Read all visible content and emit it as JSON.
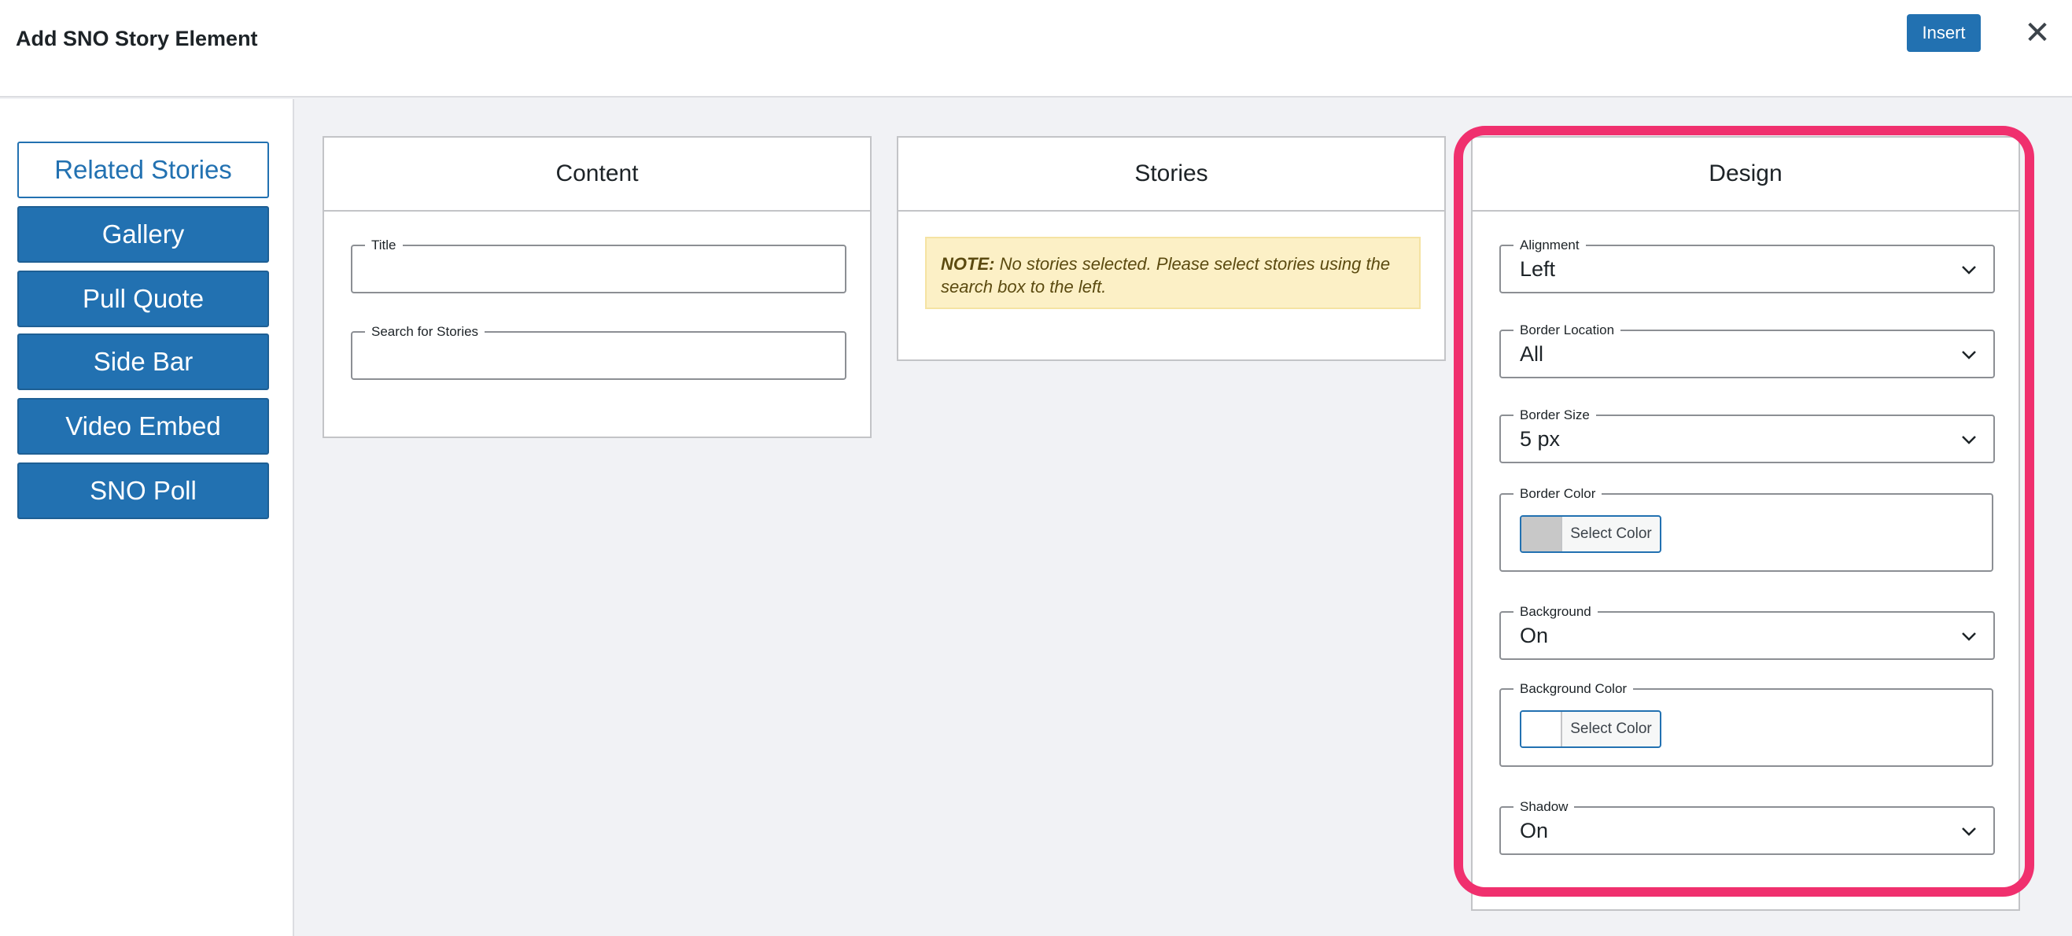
{
  "header": {
    "title": "Add SNO Story Element",
    "insert_label": "Insert",
    "close_symbol": "✕"
  },
  "sidebar": {
    "items": [
      {
        "label": "Related Stories",
        "active": true
      },
      {
        "label": "Gallery",
        "active": false
      },
      {
        "label": "Pull Quote",
        "active": false
      },
      {
        "label": "Side Bar",
        "active": false
      },
      {
        "label": "Video Embed",
        "active": false
      },
      {
        "label": "SNO Poll",
        "active": false
      }
    ]
  },
  "content_panel": {
    "heading": "Content",
    "title_field": {
      "label": "Title",
      "value": ""
    },
    "search_field": {
      "label": "Search for Stories",
      "value": ""
    }
  },
  "stories_panel": {
    "heading": "Stories",
    "note_label": "NOTE:",
    "note_text": "No stories selected. Please select stories using the search box to the left."
  },
  "design_panel": {
    "heading": "Design",
    "alignment": {
      "label": "Alignment",
      "value": "Left"
    },
    "border_location": {
      "label": "Border Location",
      "value": "All"
    },
    "border_size": {
      "label": "Border Size",
      "value": "5 px"
    },
    "border_color": {
      "label": "Border Color",
      "button_label": "Select Color",
      "swatch": "#c8c8c8"
    },
    "background": {
      "label": "Background",
      "value": "On"
    },
    "background_color": {
      "label": "Background Color",
      "button_label": "Select Color",
      "swatch": "#ffffff"
    },
    "shadow": {
      "label": "Shadow",
      "value": "On"
    }
  },
  "colors": {
    "accent": "#2271b1",
    "highlight": "#f0306e",
    "note_bg": "#fcf0c6"
  }
}
